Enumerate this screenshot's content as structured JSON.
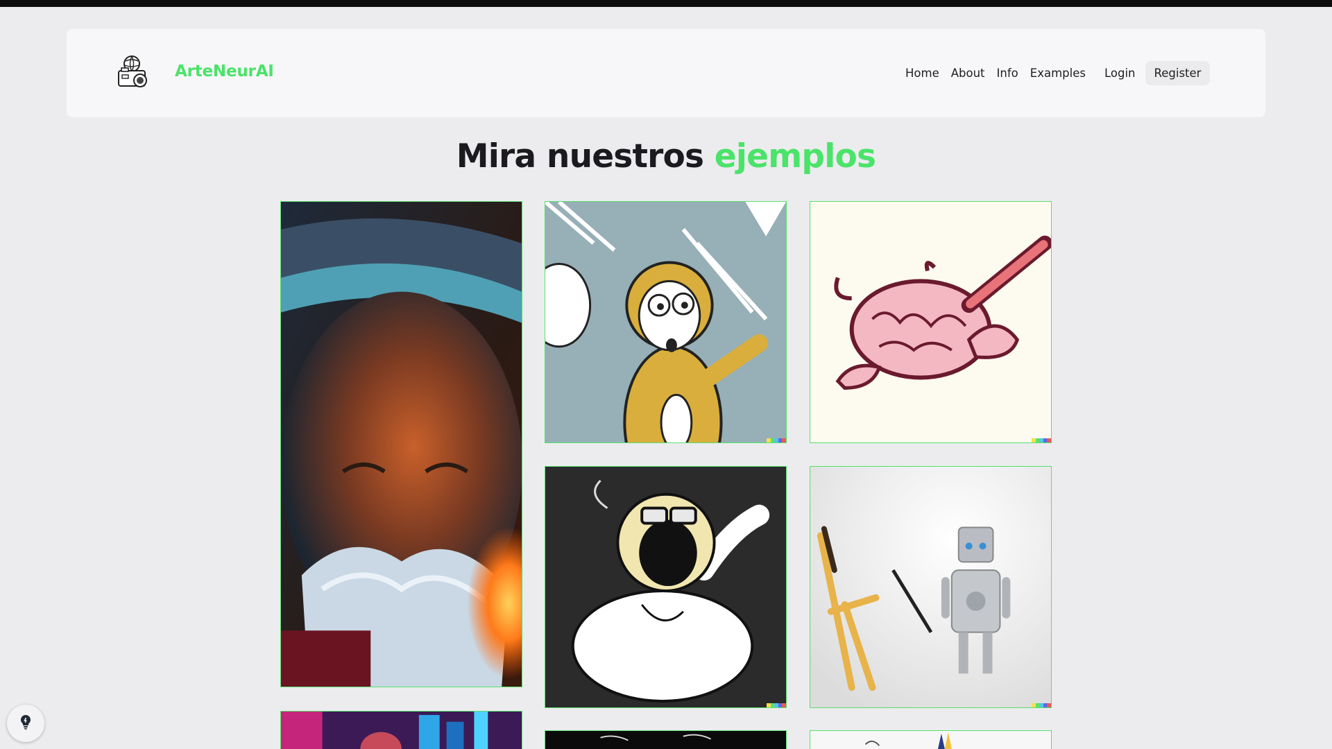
{
  "brand": {
    "name": "ArteNeurAI",
    "color": "#4be36a",
    "logo_icon": "camera-globe-icon"
  },
  "nav": {
    "links": [
      "Home",
      "About",
      "Info",
      "Examples"
    ],
    "login": "Login",
    "register": "Register"
  },
  "heading": {
    "part1": "Mira nuestros",
    "part2": "ejemplos"
  },
  "gallery": [
    {
      "name": "old-man-fire-portrait"
    },
    {
      "name": "cartoon-monkey-pointing"
    },
    {
      "name": "brain-drawing-with-pencil"
    },
    {
      "name": "white-ape-sunglasses"
    },
    {
      "name": "toy-robot-painter"
    },
    {
      "name": "neon-city-portrait"
    },
    {
      "name": "dark-sketch"
    },
    {
      "name": "colorful-illustration"
    }
  ],
  "hint_button": {
    "icon": "lightbulb-icon"
  }
}
